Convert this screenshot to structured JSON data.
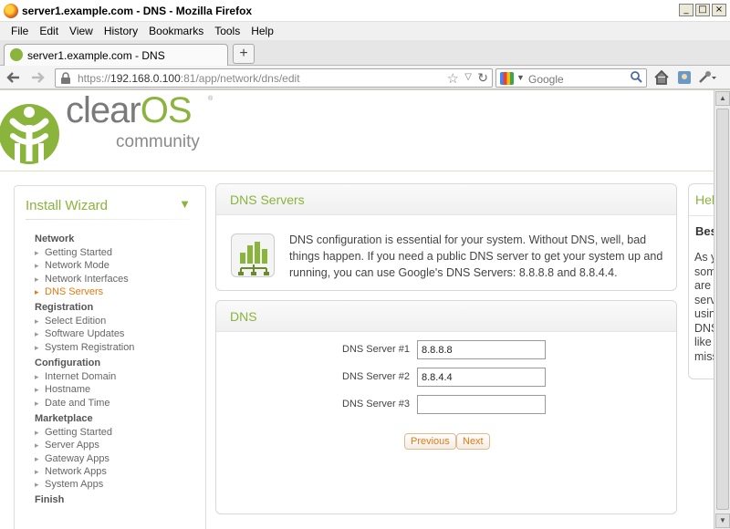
{
  "window": {
    "title": "server1.example.com - DNS - Mozilla Firefox",
    "controls": [
      "_",
      "□",
      "×"
    ]
  },
  "menu": {
    "items": [
      "File",
      "Edit",
      "View",
      "History",
      "Bookmarks",
      "Tools",
      "Help"
    ]
  },
  "tabs": [
    {
      "label": "server1.example.com - DNS"
    }
  ],
  "newtab_label": "+",
  "navbar": {
    "url_scheme": "https://",
    "url_host": "192.168.0.100",
    "url_rest": ":81/app/network/dns/edit",
    "search_placeholder": "Google"
  },
  "logo": {
    "brand_main": "clear",
    "brand_accent": "OS",
    "tm": "®",
    "edition": "community",
    "accent_color": "#8ab43c"
  },
  "sidebar": {
    "title": "Install Wizard",
    "sections": [
      {
        "name": "Network",
        "items": [
          "Getting Started",
          "Network Mode",
          "Network Interfaces",
          "DNS Servers"
        ]
      },
      {
        "name": "Registration",
        "items": [
          "Select Edition",
          "Software Updates",
          "System Registration"
        ]
      },
      {
        "name": "Configuration",
        "items": [
          "Internet Domain",
          "Hostname",
          "Date and Time"
        ]
      },
      {
        "name": "Marketplace",
        "items": [
          "Getting Started",
          "Server Apps",
          "Gateway Apps",
          "Network Apps",
          "System Apps"
        ]
      },
      {
        "name": "Finish",
        "items": []
      }
    ],
    "active_item": "DNS Servers"
  },
  "dns_servers_panel": {
    "title": "DNS Servers",
    "description": "DNS configuration is essential for your system. Without DNS, well, bad things happen. If you need a public DNS server to get your system up and running, you can use Google's DNS Servers: 8.8.8.8 and 8.8.4.4."
  },
  "dns_form": {
    "title": "DNS",
    "fields": [
      {
        "label": "DNS Server #1",
        "value": "8.8.8.8"
      },
      {
        "label": "DNS Server #2",
        "value": "8.8.4.4"
      },
      {
        "label": "DNS Server #3",
        "value": ""
      }
    ]
  },
  "buttons": {
    "previous": "Previous",
    "next": "Next"
  },
  "help_panel": {
    "title": "Hel",
    "subtitle": "Bes",
    "body_lines": [
      "As y",
      "som",
      "are",
      "serv",
      "usin",
      "DNS",
      "like",
      "miss"
    ]
  },
  "colors": {
    "accent_green": "#8ab43c",
    "active_orange": "#e6780f"
  }
}
